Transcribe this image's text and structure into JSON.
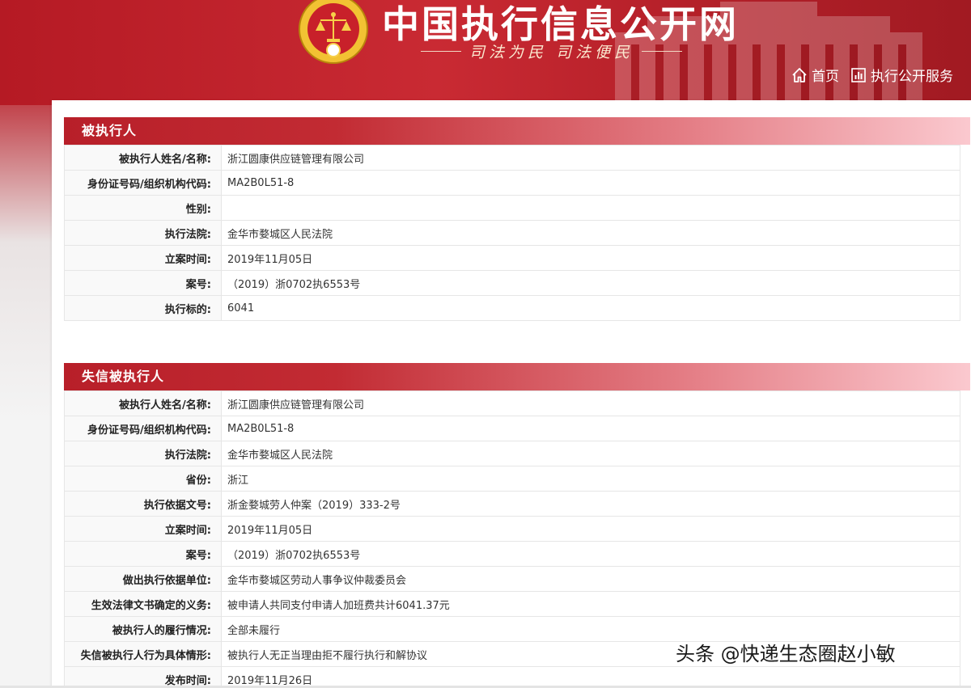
{
  "header": {
    "site_title": "中国执行信息公开网",
    "slogan": "司法为民  司法便民",
    "nav": [
      {
        "label": "首页",
        "icon": "home-icon"
      },
      {
        "label": "执行公开服务",
        "icon": "chart-icon"
      }
    ],
    "colors": {
      "primary": "#c22b33",
      "accent": "#f7d049"
    }
  },
  "section1": {
    "title": "被执行人",
    "rows": [
      {
        "label": "被执行人姓名/名称:",
        "value": "浙江圆康供应链管理有限公司"
      },
      {
        "label": "身份证号码/组织机构代码:",
        "value": "MA2B0L51-8"
      },
      {
        "label": "性别:",
        "value": ""
      },
      {
        "label": "执行法院:",
        "value": "金华市婺城区人民法院"
      },
      {
        "label": "立案时间:",
        "value": "2019年11月05日"
      },
      {
        "label": "案号:",
        "value": "（2019）浙0702执6553号"
      },
      {
        "label": "执行标的:",
        "value": "6041"
      }
    ]
  },
  "section2": {
    "title": "失信被执行人",
    "rows": [
      {
        "label": "被执行人姓名/名称:",
        "value": "浙江圆康供应链管理有限公司"
      },
      {
        "label": "身份证号码/组织机构代码:",
        "value": "MA2B0L51-8"
      },
      {
        "label": "执行法院:",
        "value": "金华市婺城区人民法院"
      },
      {
        "label": "省份:",
        "value": "浙江"
      },
      {
        "label": "执行依据文号:",
        "value": "浙金婺城劳人仲案（2019）333-2号"
      },
      {
        "label": "立案时间:",
        "value": "2019年11月05日"
      },
      {
        "label": "案号:",
        "value": "（2019）浙0702执6553号"
      },
      {
        "label": "做出执行依据单位:",
        "value": "金华市婺城区劳动人事争议仲裁委员会"
      },
      {
        "label": "生效法律文书确定的义务:",
        "value": "被申请人共同支付申请人加班费共计6041.37元"
      },
      {
        "label": "被执行人的履行情况:",
        "value": "全部未履行"
      },
      {
        "label": "失信被执行人行为具体情形:",
        "value": "被执行人无正当理由拒不履行执行和解协议"
      },
      {
        "label": "发布时间:",
        "value": "2019年11月26日"
      }
    ]
  },
  "watermark": "头条 @快递生态圈赵小敏"
}
